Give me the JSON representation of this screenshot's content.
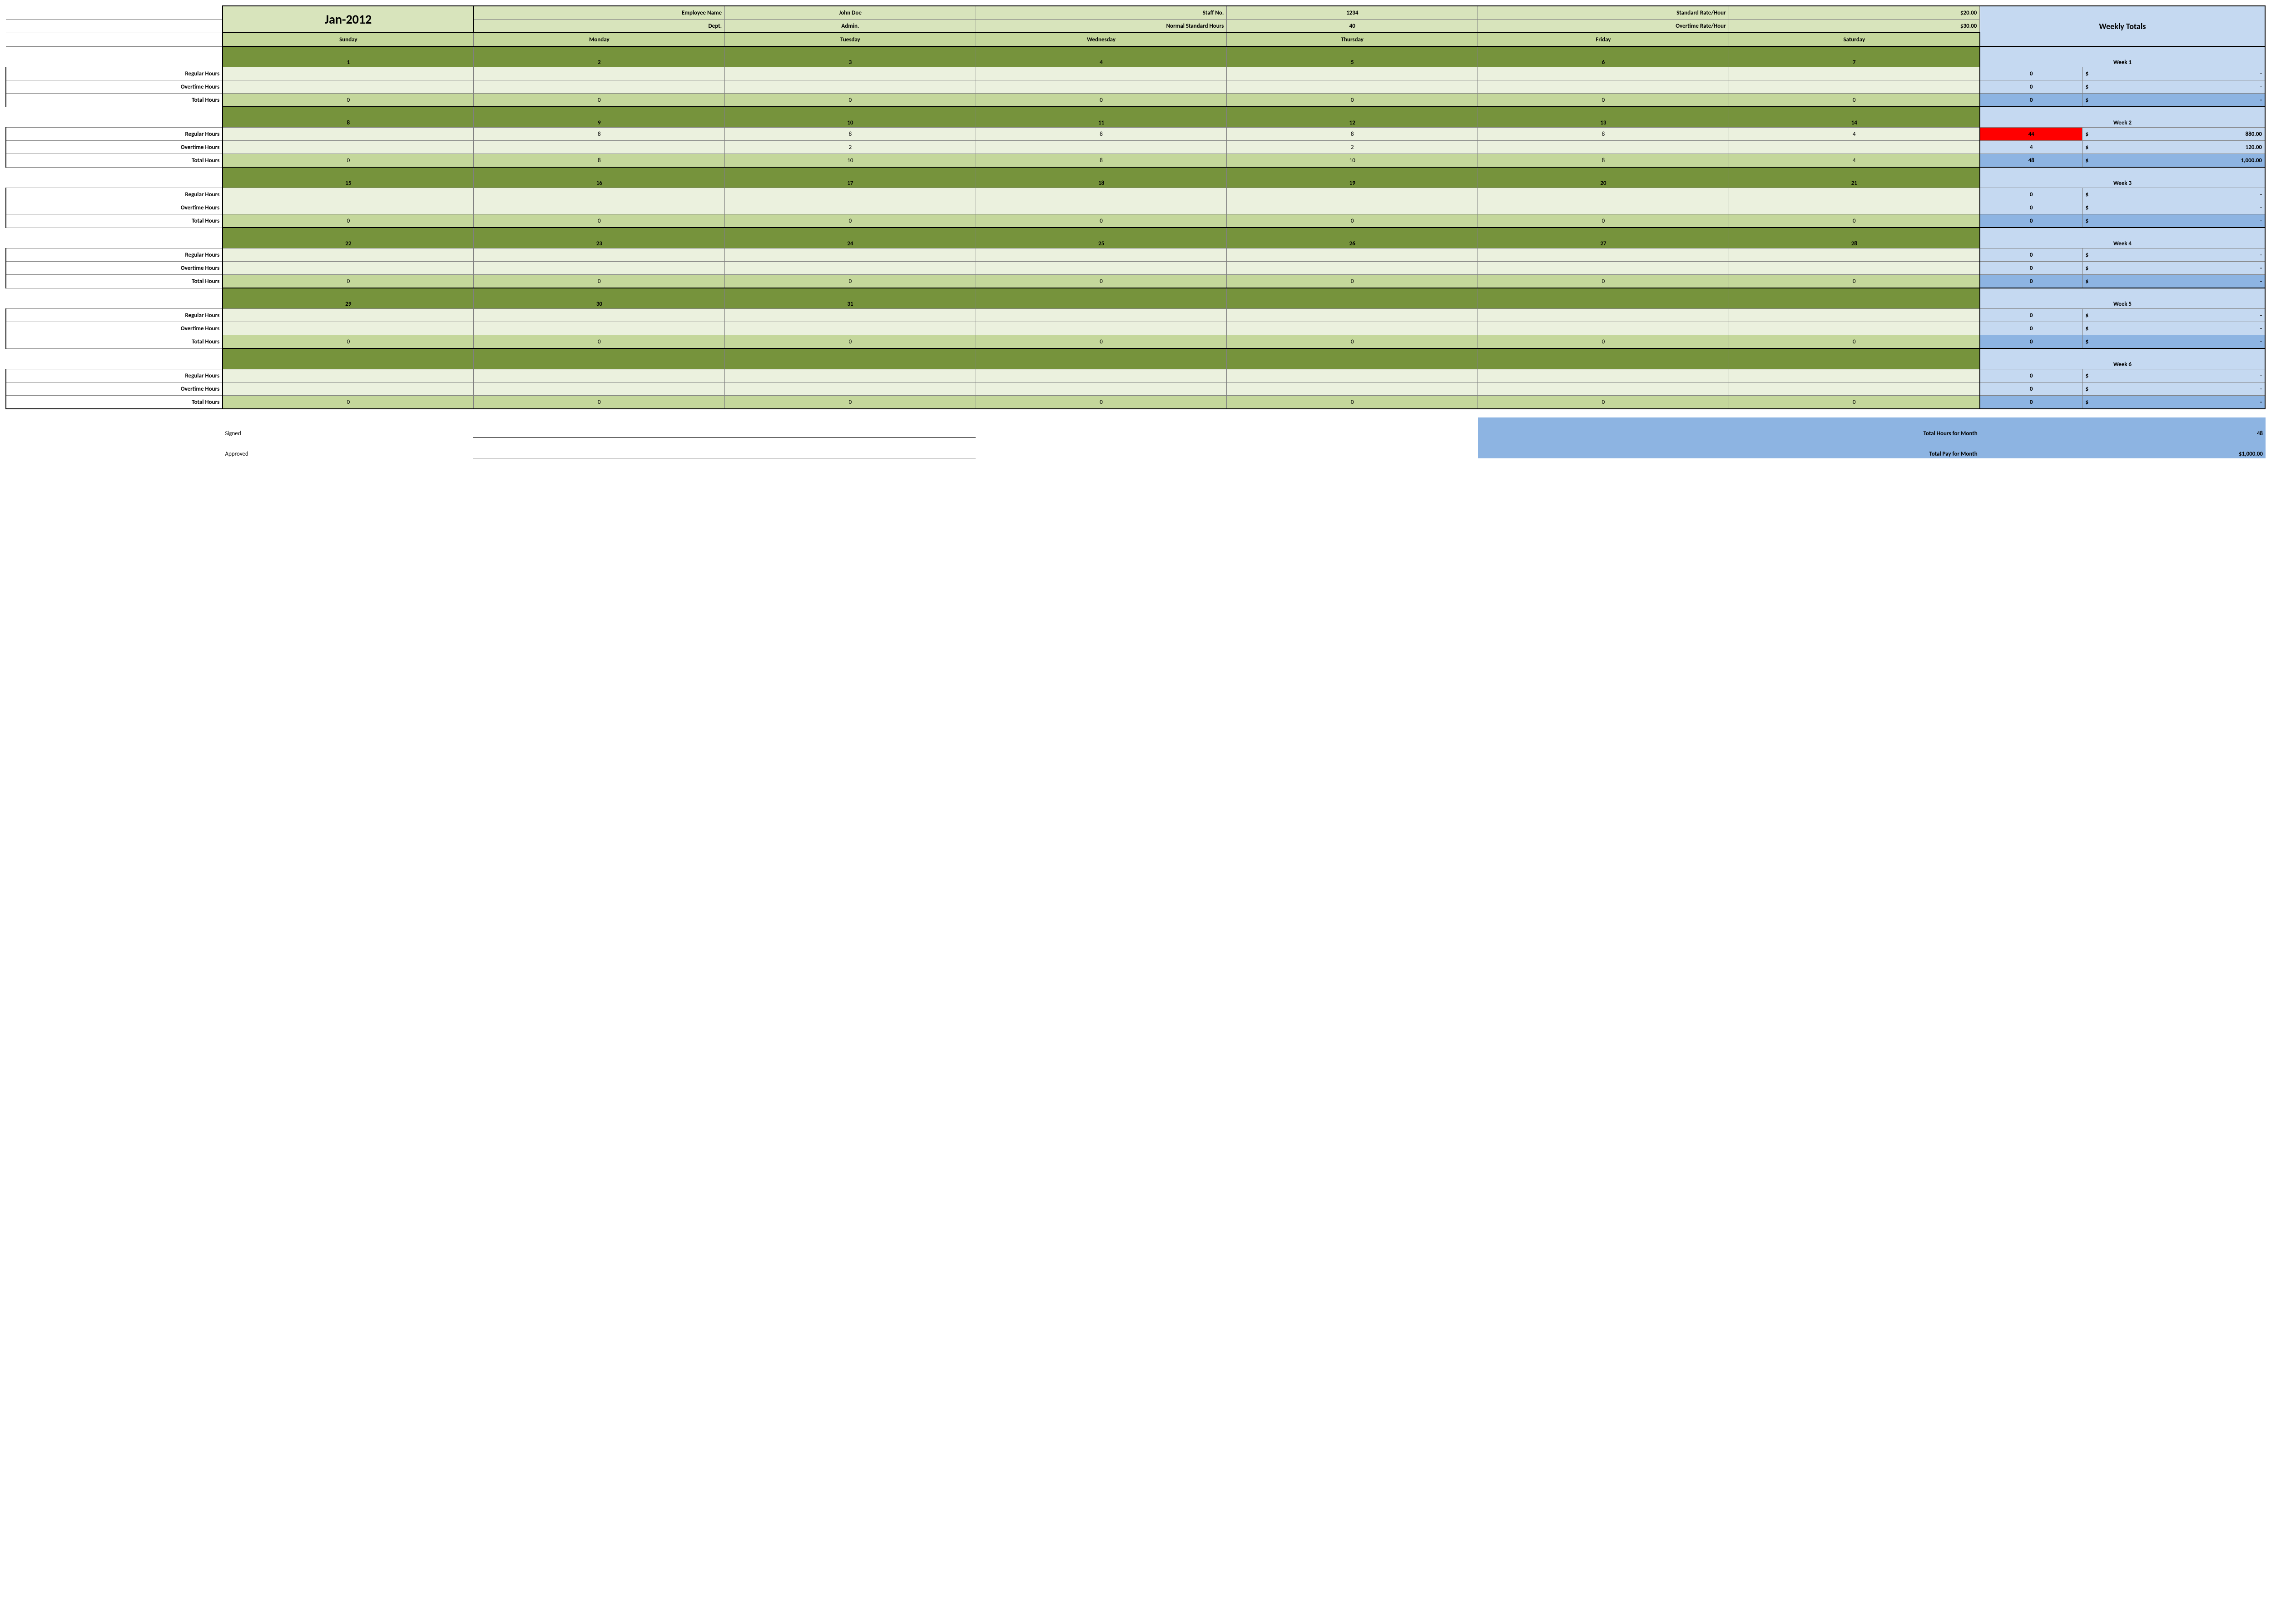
{
  "header": {
    "month": "Jan-2012",
    "empNameLbl": "Employee Name",
    "empName": "John Doe",
    "staffNoLbl": "Staff No.",
    "staffNo": "1234",
    "stdRateLbl": "Standard Rate/Hour",
    "stdRate": "$20.00",
    "deptLbl": "Dept.",
    "dept": "Admin.",
    "normHrsLbl": "Normal Standard Hours",
    "normHrs": "40",
    "otRateLbl": "Overtime Rate/Hour",
    "otRate": "$30.00"
  },
  "days": [
    "Sunday",
    "Monday",
    "Tuesday",
    "Wednesday",
    "Thursday",
    "Friday",
    "Saturday"
  ],
  "weeklyTotalsLabel": "Weekly Totals",
  "rowLabels": {
    "reg": "Regular Hours",
    "ot": "Overtime Hours",
    "tot": "Total Hours"
  },
  "weeks": [
    {
      "label": "Week 1",
      "nums": [
        "1",
        "2",
        "3",
        "4",
        "5",
        "6",
        "7"
      ],
      "reg": [
        "",
        "",
        "",
        "",
        "",
        "",
        ""
      ],
      "ot": [
        "",
        "",
        "",
        "",
        "",
        "",
        ""
      ],
      "tot": [
        "0",
        "0",
        "0",
        "0",
        "0",
        "0",
        "0"
      ],
      "regSum": "0",
      "regAmt": "-",
      "regHighlight": false,
      "otSum": "0",
      "otAmt": "-",
      "totSum": "0",
      "totAmt": "-"
    },
    {
      "label": "Week 2",
      "nums": [
        "8",
        "9",
        "10",
        "11",
        "12",
        "13",
        "14"
      ],
      "reg": [
        "",
        "8",
        "8",
        "8",
        "8",
        "8",
        "4"
      ],
      "ot": [
        "",
        "",
        "2",
        "",
        "2",
        "",
        ""
      ],
      "tot": [
        "0",
        "8",
        "10",
        "8",
        "10",
        "8",
        "4"
      ],
      "regSum": "44",
      "regAmt": "880.00",
      "regHighlight": true,
      "otSum": "4",
      "otAmt": "120.00",
      "totSum": "48",
      "totAmt": "1,000.00"
    },
    {
      "label": "Week 3",
      "nums": [
        "15",
        "16",
        "17",
        "18",
        "19",
        "20",
        "21"
      ],
      "reg": [
        "",
        "",
        "",
        "",
        "",
        "",
        ""
      ],
      "ot": [
        "",
        "",
        "",
        "",
        "",
        "",
        ""
      ],
      "tot": [
        "0",
        "0",
        "0",
        "0",
        "0",
        "0",
        "0"
      ],
      "regSum": "0",
      "regAmt": "-",
      "regHighlight": false,
      "otSum": "0",
      "otAmt": "-",
      "totSum": "0",
      "totAmt": "-"
    },
    {
      "label": "Week 4",
      "nums": [
        "22",
        "23",
        "24",
        "25",
        "26",
        "27",
        "28"
      ],
      "reg": [
        "",
        "",
        "",
        "",
        "",
        "",
        ""
      ],
      "ot": [
        "",
        "",
        "",
        "",
        "",
        "",
        ""
      ],
      "tot": [
        "0",
        "0",
        "0",
        "0",
        "0",
        "0",
        "0"
      ],
      "regSum": "0",
      "regAmt": "-",
      "regHighlight": false,
      "otSum": "0",
      "otAmt": "-",
      "totSum": "0",
      "totAmt": "-"
    },
    {
      "label": "Week 5",
      "nums": [
        "29",
        "30",
        "31",
        "",
        "",
        "",
        ""
      ],
      "reg": [
        "",
        "",
        "",
        "",
        "",
        "",
        ""
      ],
      "ot": [
        "",
        "",
        "",
        "",
        "",
        "",
        ""
      ],
      "tot": [
        "0",
        "0",
        "0",
        "0",
        "0",
        "0",
        "0"
      ],
      "regSum": "0",
      "regAmt": "-",
      "regHighlight": false,
      "otSum": "0",
      "otAmt": "-",
      "totSum": "0",
      "totAmt": "-"
    },
    {
      "label": "Week 6",
      "nums": [
        "",
        "",
        "",
        "",
        "",
        "",
        ""
      ],
      "reg": [
        "",
        "",
        "",
        "",
        "",
        "",
        ""
      ],
      "ot": [
        "",
        "",
        "",
        "",
        "",
        "",
        ""
      ],
      "tot": [
        "0",
        "0",
        "0",
        "0",
        "0",
        "0",
        "0"
      ],
      "regSum": "0",
      "regAmt": "-",
      "regHighlight": false,
      "otSum": "0",
      "otAmt": "-",
      "totSum": "0",
      "totAmt": "-"
    }
  ],
  "footer": {
    "signed": "Signed",
    "approved": "Approved",
    "totHrsLbl": "Total Hours for Month",
    "totHrs": "48",
    "totPayLbl": "Total Pay for Month",
    "totPay": "$1,000.00"
  },
  "currency": "$"
}
